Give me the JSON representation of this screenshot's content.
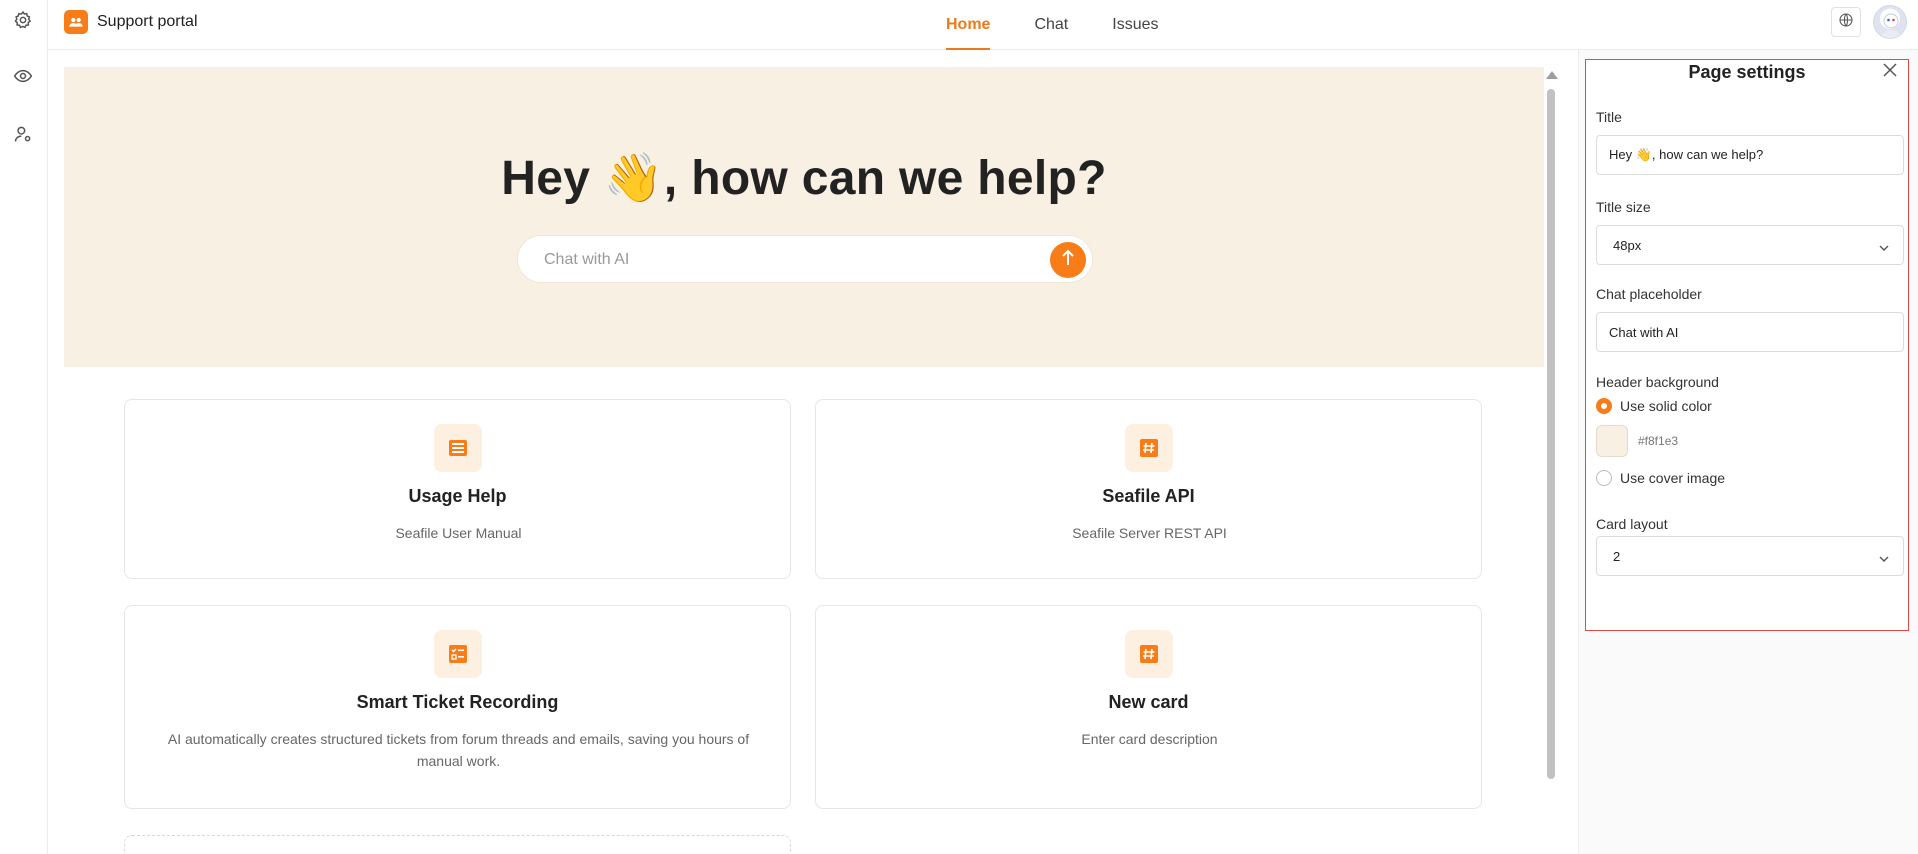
{
  "app": {
    "name": "Support portal",
    "accent": "#f87c17",
    "tab_accent": "#ec7b1b"
  },
  "rail": {
    "icons": [
      "gear-icon",
      "eye-icon",
      "user-settings-icon"
    ]
  },
  "nav": {
    "tabs": [
      {
        "label": "Home",
        "active": true
      },
      {
        "label": "Chat",
        "active": false
      },
      {
        "label": "Issues",
        "active": false
      }
    ]
  },
  "topbar_right": {
    "icons": [
      "globe-icon",
      "avatar"
    ]
  },
  "hero": {
    "title": "Hey 👋, how can we help?",
    "background": "#f8f1e3",
    "chat_placeholder": "Chat with AI"
  },
  "cards": [
    {
      "title": "Usage Help",
      "description": "Seafile User Manual",
      "icon": "list-icon"
    },
    {
      "title": "Seafile API",
      "description": "Seafile Server REST API",
      "icon": "hash-icon"
    },
    {
      "title": "Smart Ticket Recording",
      "description": "AI automatically creates structured tickets from forum threads and emails, saving you hours of manual work.",
      "icon": "checklist-icon"
    },
    {
      "title": "New card",
      "description": "Enter card description",
      "icon": "hash-icon"
    }
  ],
  "settings": {
    "panel_title": "Page settings",
    "title_label": "Title",
    "title_value": "Hey 👋, how can we help?",
    "title_size_label": "Title size",
    "title_size_value": "48px",
    "chat_placeholder_label": "Chat placeholder",
    "chat_placeholder_value": "Chat with AI",
    "header_background_label": "Header background",
    "option_solid": "Use solid color",
    "option_cover": "Use cover image",
    "selected_option": "solid",
    "color_hex": "#f8f1e3",
    "card_layout_label": "Card layout",
    "card_layout_value": "2"
  }
}
